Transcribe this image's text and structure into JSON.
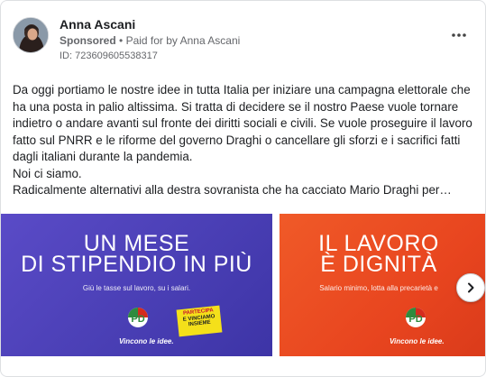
{
  "post": {
    "author": "Anna Ascani",
    "sponsored_label": "Sponsored",
    "separator": "•",
    "paid_for": "Paid for by Anna Ascani",
    "ad_id": "ID: 723609605538317",
    "more_icon": "more-horizontal-icon",
    "paragraphs": [
      "Da oggi portiamo le nostre idee in tutta Italia per iniziare una campagna elettorale che ha una posta in palio altissima. Si tratta di decidere se il nostro Paese vuole tornare indietro o andare avanti sul fronte dei diritti sociali e civili. Se vuole proseguire il lavoro fatto sul PNRR e le riforme del governo Draghi o cancellare gli sforzi e i sacrifici fatti dagli italiani durante la pandemia.",
      "Noi ci siamo.",
      "Radicalmente alternativi alla destra sovranista che ha cacciato Mario Draghi per…"
    ]
  },
  "carousel": {
    "slides": [
      {
        "headline_line1": "UN MESE",
        "headline_line2": "DI STIPENDIO IN PIÙ",
        "subtitle": "Giù le tasse sul lavoro, su i salari.",
        "logo_text": "PD",
        "tagline": "Vincono le idee.",
        "sticker_line1": "PARTECIPA",
        "sticker_line2": "E VINCIAMO",
        "sticker_line3": "INSIEME",
        "background": "#4a3fb5"
      },
      {
        "headline_line1": "IL LAVORO",
        "headline_line2": "È DIGNITÀ",
        "subtitle": "Salario minimo, lotta alla precarietà e",
        "logo_text": "PD",
        "tagline": "Vincono le idee.",
        "background": "#e8451f"
      }
    ],
    "next_icon": "chevron-right-icon"
  },
  "colors": {
    "text_primary": "#1c1e21",
    "text_secondary": "#65676b",
    "pd_green": "#2e8b3e",
    "pd_red": "#d52b1e"
  }
}
